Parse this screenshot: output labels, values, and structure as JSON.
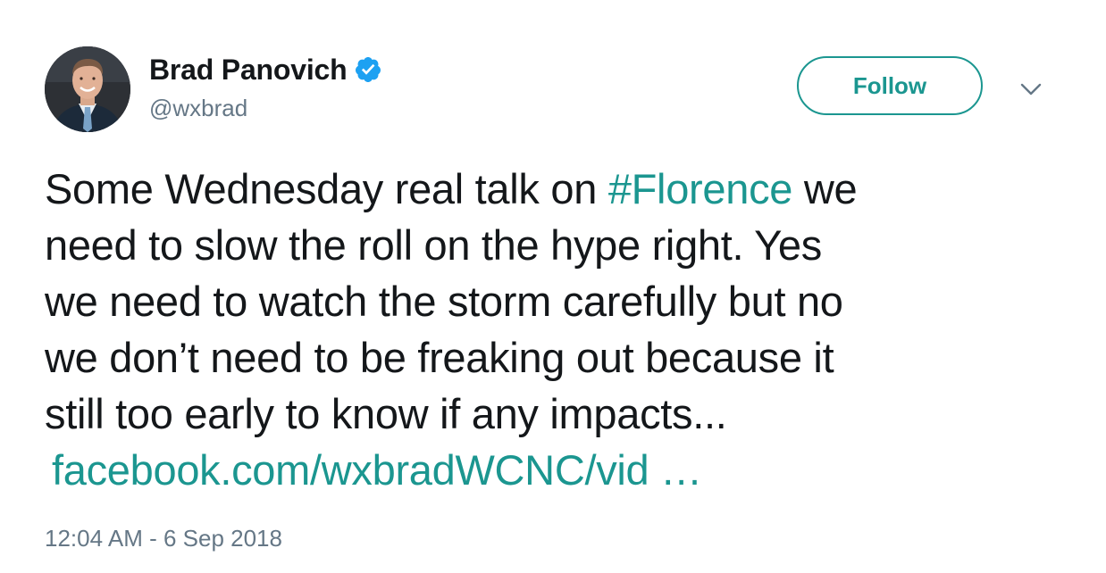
{
  "author": {
    "display_name": "Brad Panovich",
    "handle": "@wxbrad",
    "verified": true,
    "avatar_icon": "user-avatar"
  },
  "actions": {
    "follow_label": "Follow",
    "more_icon": "chevron-down-icon"
  },
  "tweet": {
    "lines": [
      {
        "before": "Some Wednesday real talk on ",
        "hashtag": "#Florence",
        "after": " we"
      },
      "need to slow the roll on the hype right. Yes",
      "we need to watch the storm carefully but no",
      "we don’t need to be freaking out because it",
      "still too early to know if any impacts..."
    ],
    "link_text": "facebook.com/wxbradWCNC/vid …"
  },
  "timestamp": "12:04 AM - 6 Sep 2018",
  "colors": {
    "accent": "#1b9690",
    "verified": "#1da1f2",
    "secondary_text": "#657786",
    "primary_text": "#14171a"
  }
}
